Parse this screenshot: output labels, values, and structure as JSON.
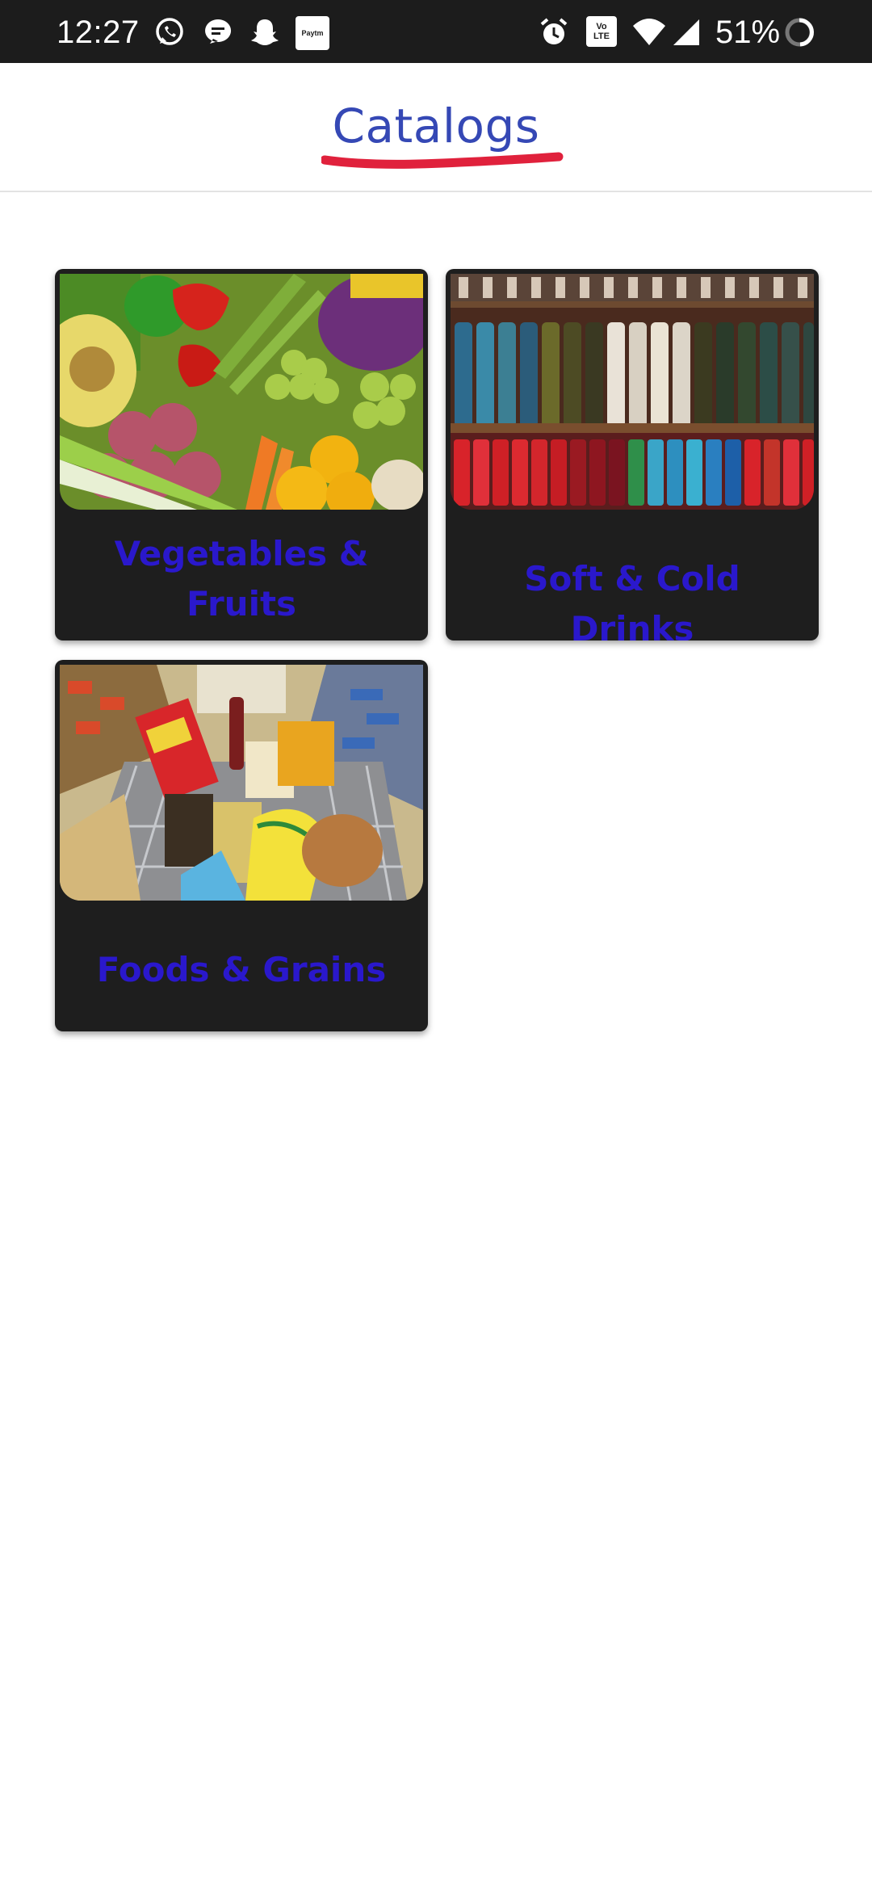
{
  "status_bar": {
    "time": "12:27",
    "battery_percent": "51%",
    "left_icons": [
      "whatsapp-icon",
      "messages-icon",
      "snapchat-icon",
      "paytm-icon"
    ],
    "right_icons": [
      "alarm-icon",
      "volte-icon",
      "wifi-icon",
      "signal-icon",
      "battery-ring-icon"
    ],
    "paytm_text": "Paytm",
    "volte_text": "Vo LTE"
  },
  "header": {
    "title": "Catalogs",
    "title_color": "#3548b5",
    "underline_color": "#e0213c"
  },
  "catalogs": [
    {
      "label": "Vegetables & Fruits",
      "image": "vegetables-fruits-photo"
    },
    {
      "label": "Soft & Cold Drinks",
      "image": "drinks-shelf-photo"
    },
    {
      "label": "Foods & Grains",
      "image": "grocery-cart-photo"
    }
  ],
  "colors": {
    "card_background": "#1e1e1e",
    "card_label": "#2a18cc",
    "status_bar": "#1c1c1c"
  }
}
